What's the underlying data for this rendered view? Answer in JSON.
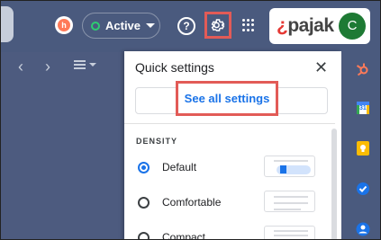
{
  "header": {
    "status_label": "Active",
    "help_glyph": "?",
    "hubspot_glyph": "h",
    "account": {
      "brand_prefix": "¿",
      "brand_rest": "pajak",
      "avatar_initial": "C"
    }
  },
  "toolbar": {
    "prev_glyph": "‹",
    "next_glyph": "›"
  },
  "quick_settings": {
    "title": "Quick settings",
    "close_glyph": "✕",
    "see_all_label": "See all settings",
    "density_heading": "DENSITY",
    "density_options": [
      {
        "label": "Default",
        "selected": true
      },
      {
        "label": "Comfortable",
        "selected": false
      },
      {
        "label": "Compact",
        "selected": false
      }
    ]
  },
  "side_panel": {
    "icons": [
      "hubspot-icon",
      "calendar-icon",
      "keep-icon",
      "tasks-icon",
      "contacts-icon"
    ],
    "calendar_day": "31"
  },
  "colors": {
    "background": "#4d5b7f",
    "highlight": "#e25b57",
    "accent": "#1a73e8",
    "status_green": "#2ecc71",
    "avatar": "#1e7a34",
    "hubspot": "#ff7a59"
  }
}
